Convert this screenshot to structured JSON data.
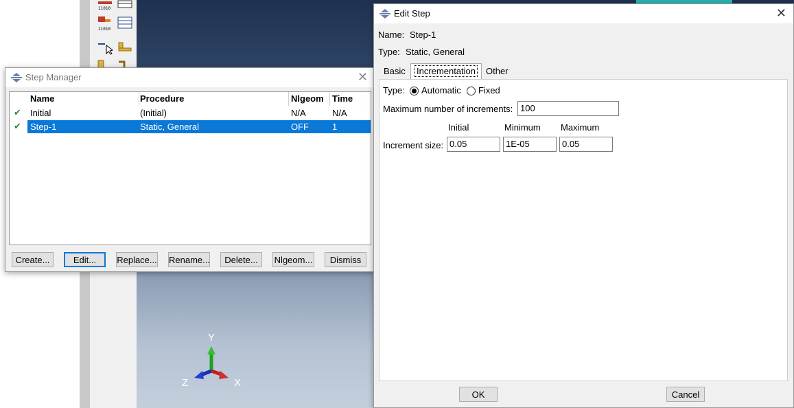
{
  "step_manager": {
    "title": "Step Manager",
    "close_glyph": "✕",
    "columns": [
      "Name",
      "Procedure",
      "Nlgeom",
      "Time"
    ],
    "rows": [
      {
        "check": "✔",
        "name": "Initial",
        "procedure": "(Initial)",
        "nlgeom": "N/A",
        "time": "N/A",
        "selected": false
      },
      {
        "check": "✔",
        "name": "Step-1",
        "procedure": "Static, General",
        "nlgeom": "OFF",
        "time": "1",
        "selected": true
      }
    ],
    "buttons": [
      "Create...",
      "Edit...",
      "Replace...",
      "Rename...",
      "Delete...",
      "Nlgeom...",
      "Dismiss"
    ]
  },
  "edit_step": {
    "title": "Edit Step",
    "close_glyph": "✕",
    "name_label": "Name:",
    "name_value": "Step-1",
    "type_label": "Type:",
    "type_value": "Static, General",
    "tabs": [
      "Basic",
      "Incrementation",
      "Other"
    ],
    "active_tab": "Incrementation",
    "incrementation": {
      "type_label": "Type:",
      "type_options": [
        "Automatic",
        "Fixed"
      ],
      "type_selected": "Automatic",
      "max_increments_label": "Maximum number of increments:",
      "max_increments_value": "100",
      "col_initial": "Initial",
      "col_minimum": "Minimum",
      "col_maximum": "Maximum",
      "increment_size_label": "Increment size:",
      "initial_value": "0.05",
      "minimum_value": "1E-05",
      "maximum_value": "0.05"
    },
    "ok_label": "OK",
    "cancel_label": "Cancel"
  },
  "viewport": {
    "axis_y": "Y",
    "axis_x": "X",
    "axis_z": "Z"
  },
  "colors": {
    "selection": "#0a78d7",
    "check_green": "#2e8b2e",
    "mesh_cyan": "#27b3b3"
  },
  "icons": [
    "abaqus-dialog-icon",
    "close-icon",
    "check-icon",
    "radio-button-icon",
    "toolbox-icons"
  ]
}
